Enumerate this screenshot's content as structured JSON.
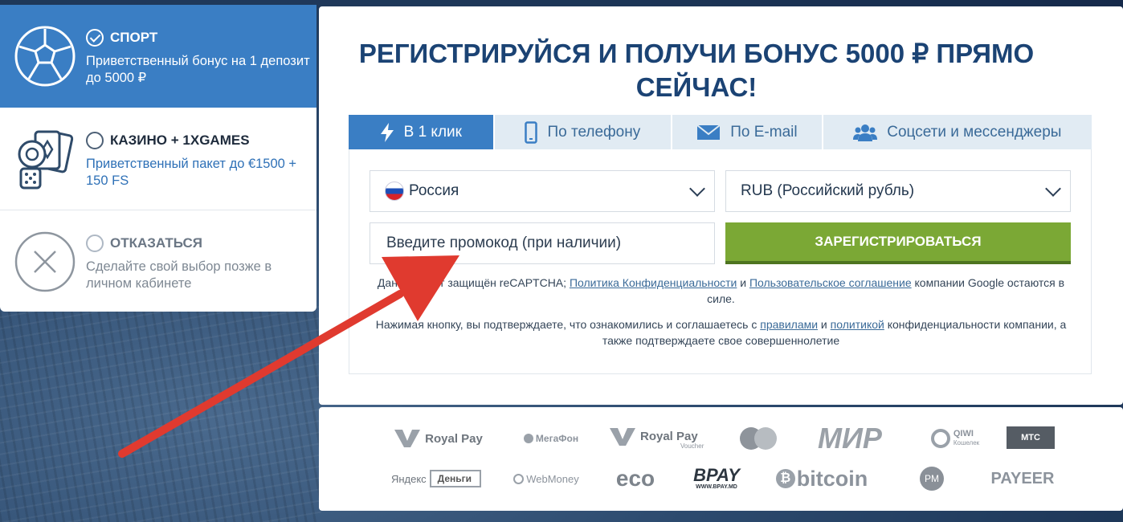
{
  "left_panel": {
    "options": [
      {
        "title": "СПОРТ",
        "desc": "Приветственный бонус на 1 депозит до 5000 ₽",
        "selected": true,
        "icon": "soccer-ball-icon"
      },
      {
        "title": "КАЗИНО + 1XGAMES",
        "desc": "Приветственный пакет до €1500 + 150 FS",
        "selected": false,
        "icon": "casino-chips-cards-icon"
      },
      {
        "title": "ОТКАЗАТЬСЯ",
        "desc": "Сделайте свой выбор позже в личном кабинете",
        "selected": false,
        "icon": "cross-circle-icon"
      }
    ]
  },
  "main": {
    "headline": "РЕГИСТРИРУЙСЯ И ПОЛУЧИ БОНУС 5000 ₽ ПРЯМО СЕЙЧАС!",
    "tabs": [
      {
        "label": "В 1 клик",
        "icon": "lightning-icon",
        "active": true
      },
      {
        "label": "По телефону",
        "icon": "phone-icon",
        "active": false
      },
      {
        "label": "По E-mail",
        "icon": "envelope-icon",
        "active": false
      },
      {
        "label": "Соцсети и мессенджеры",
        "icon": "users-icon",
        "active": false
      }
    ],
    "form": {
      "country": "Россия",
      "currency": "RUB (Российский рубль)",
      "promo_placeholder": "Введите промокод (при наличии)",
      "register_label": "ЗАРЕГИСТРИРОВАТЬСЯ"
    },
    "legal1": {
      "before": "Данный сайт защищён reCAPTCHA; ",
      "link1": "Политика Конфиденциальности",
      "and": " и ",
      "link2": "Пользовательское соглашение",
      "after": " компании Google остаются в силе."
    },
    "legal2": {
      "before": "Нажимая кнопку, вы подтверждаете, что ознакомились и соглашаетесь с ",
      "link1": "правилами",
      "and": " и ",
      "link2": "политикой",
      "after": " конфиденциальности компании, а также подтверждаете свое совершеннолетие"
    }
  },
  "payments": {
    "row1": [
      "Royal Pay",
      "МегаФон",
      "Royal Pay",
      "Mastercard",
      "МИР",
      "QIWI Кошелек",
      "МТС"
    ],
    "row2": [
      "Яндекс Деньги",
      "WebMoney",
      "eco",
      "BPAY",
      "bitcoin",
      "PM",
      "PAYEER"
    ],
    "voucher": "Voucher",
    "qiwi_sub": "Кошелек",
    "bpay_sub": "WWW.BPAY.MD"
  },
  "colors": {
    "accent": "#3a7ec4",
    "headline": "#1b4374",
    "register": "#7ba835",
    "arrow": "#e03a2f"
  }
}
